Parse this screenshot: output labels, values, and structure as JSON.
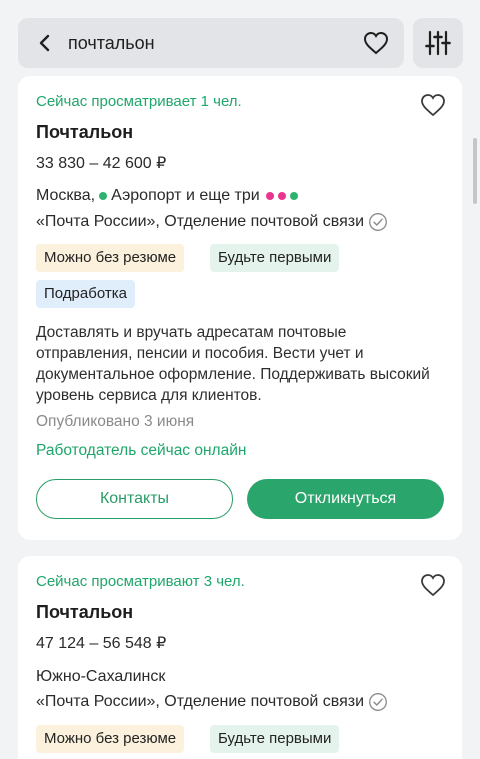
{
  "search": {
    "query": "почтальон"
  },
  "cards": [
    {
      "viewing": "Сейчас просматривает 1 чел.",
      "title": "Почтальон",
      "salary": "33 830 – 42 600 ₽",
      "city": "Москва,",
      "metro": "Аэропорт и еще три",
      "company": "«Почта России», Отделение почтовой связи",
      "tags": [
        "Можно без резюме",
        "Будьте первыми",
        "Подработка"
      ],
      "description": "Доставлять и вручать адресатам почтовые отправления, пенсии и пособия. Вести учет и документальное оформление. Поддерживать высокий уровень сервиса для клиентов.",
      "published": "Опубликовано 3 июня",
      "employer_online": "Работодатель сейчас онлайн",
      "contacts_label": "Контакты",
      "respond_label": "Откликнуться"
    },
    {
      "viewing": "Сейчас просматривают 3 чел.",
      "title": "Почтальон",
      "salary": "47 124 – 56 548 ₽",
      "city": "Южно-Сахалинск",
      "company": "«Почта России», Отделение почтовой связи",
      "tags": [
        "Можно без резюме",
        "Будьте первыми"
      ]
    }
  ],
  "colors": {
    "accent": "#2aa56c",
    "metro_line": "#2db36f",
    "metro_other": "#e8368f",
    "tag_yellow": "#fbf1dd",
    "tag_green": "#e4f4ec",
    "tag_blue": "#dfeefa"
  },
  "icons": [
    "back-arrow-icon",
    "heart-icon",
    "filter-sliders-icon",
    "verified-check-icon"
  ]
}
